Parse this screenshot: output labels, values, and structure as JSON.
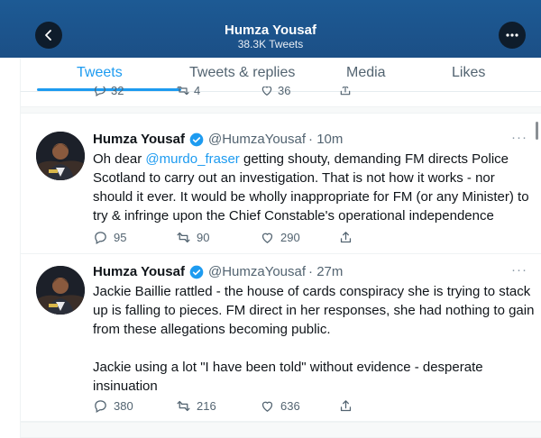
{
  "header": {
    "title": "Humza Yousaf",
    "subtitle": "38.3K Tweets"
  },
  "tabs": [
    {
      "label": "Tweets",
      "active": true
    },
    {
      "label": "Tweets & replies",
      "active": false
    },
    {
      "label": "Media",
      "active": false
    },
    {
      "label": "Likes",
      "active": false
    }
  ],
  "prior_tweet": {
    "replies": "32",
    "retweets": "4",
    "likes": "36"
  },
  "tweets": [
    {
      "name": "Humza Yousaf",
      "handle": "@HumzaYousaf",
      "time": "· 10m",
      "text_before": "Oh dear ",
      "mention": "@murdo_fraser",
      "text_after": " getting shouty, demanding FM directs Police Scotland to carry out an investigation. That is not how it works - nor should it ever. It would be wholly inappropriate for FM (or any Minister) to try & infringe upon the Chief Constable's operational independence",
      "replies": "95",
      "retweets": "90",
      "likes": "290"
    },
    {
      "name": "Humza Yousaf",
      "handle": "@HumzaYousaf",
      "time": "· 27m",
      "text": "Jackie Baillie rattled - the house of cards conspiracy she is trying to stack up is falling to pieces. FM direct in her responses, she had nothing to gain from these allegations becoming public.\n\nJackie using a lot \"I have been told\" without evidence - desperate insinuation",
      "replies": "380",
      "retweets": "216",
      "likes": "636"
    }
  ],
  "colors": {
    "header": "#1b4f86",
    "accent": "#1d9bf0",
    "text": "#0f1419",
    "muted": "#536471"
  },
  "icons": [
    "back-arrow-icon",
    "more-options-icon",
    "verified-badge-icon",
    "reply-icon",
    "retweet-icon",
    "like-icon",
    "share-icon"
  ]
}
